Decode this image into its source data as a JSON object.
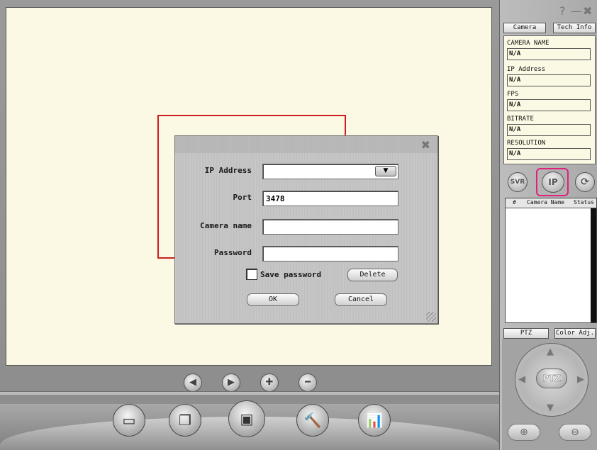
{
  "dialog": {
    "close_glyph": "✖",
    "ip_label": "IP Address",
    "ip_value": "",
    "port_label": "Port",
    "port_value": "3478",
    "camera_name_label": "Camera name",
    "camera_name_value": "",
    "password_label": "Password",
    "password_value": "",
    "save_password_label": "Save password",
    "save_password_checked": false,
    "delete_label": "Delete",
    "ok_label": "OK",
    "cancel_label": "Cancel"
  },
  "playback": {
    "buttons": [
      {
        "name": "previous",
        "glyph": "◀"
      },
      {
        "name": "play",
        "glyph": "▶"
      },
      {
        "name": "add",
        "glyph": "✚"
      },
      {
        "name": "remove",
        "glyph": "━"
      }
    ]
  },
  "toolbar": {
    "buttons": [
      {
        "name": "filmstrip",
        "glyph": "▭"
      },
      {
        "name": "window",
        "glyph": "❐"
      },
      {
        "name": "fullscreen",
        "glyph": "▣"
      },
      {
        "name": "tools",
        "glyph": "🔨"
      },
      {
        "name": "stats",
        "glyph": "📊"
      }
    ]
  },
  "window_controls": {
    "help": "?",
    "minimize": "—",
    "close": "✖"
  },
  "right_panel": {
    "tabs": {
      "camera": "Camera",
      "tech_info": "Tech Info"
    },
    "info": [
      {
        "label": "CAMERA NAME",
        "value": "N/A"
      },
      {
        "label": "IP Address",
        "value": "N/A"
      },
      {
        "label": "FPS",
        "value": "N/A"
      },
      {
        "label": "BITRATE",
        "value": "N/A"
      },
      {
        "label": "RESOLUTION",
        "value": "N/A"
      }
    ],
    "mode_buttons": {
      "svr": "SVR",
      "ip": "IP",
      "refresh": "⟳"
    },
    "list_columns": [
      "#",
      "Camera Name",
      "Status"
    ],
    "bottom_tabs": {
      "ptz": "PTZ",
      "color_adj": "Color Adj."
    },
    "ptz_center": "PTZ",
    "ptz_arrows": {
      "up": "▲",
      "down": "▼",
      "left": "◀",
      "right": "▶"
    },
    "zoom_in": "⊕",
    "zoom_out": "⊖"
  },
  "colors": {
    "viewport_bg": "#fbf9e3",
    "highlight_red": "#cc1f1f",
    "ip_button_highlight": "#e0237a"
  }
}
